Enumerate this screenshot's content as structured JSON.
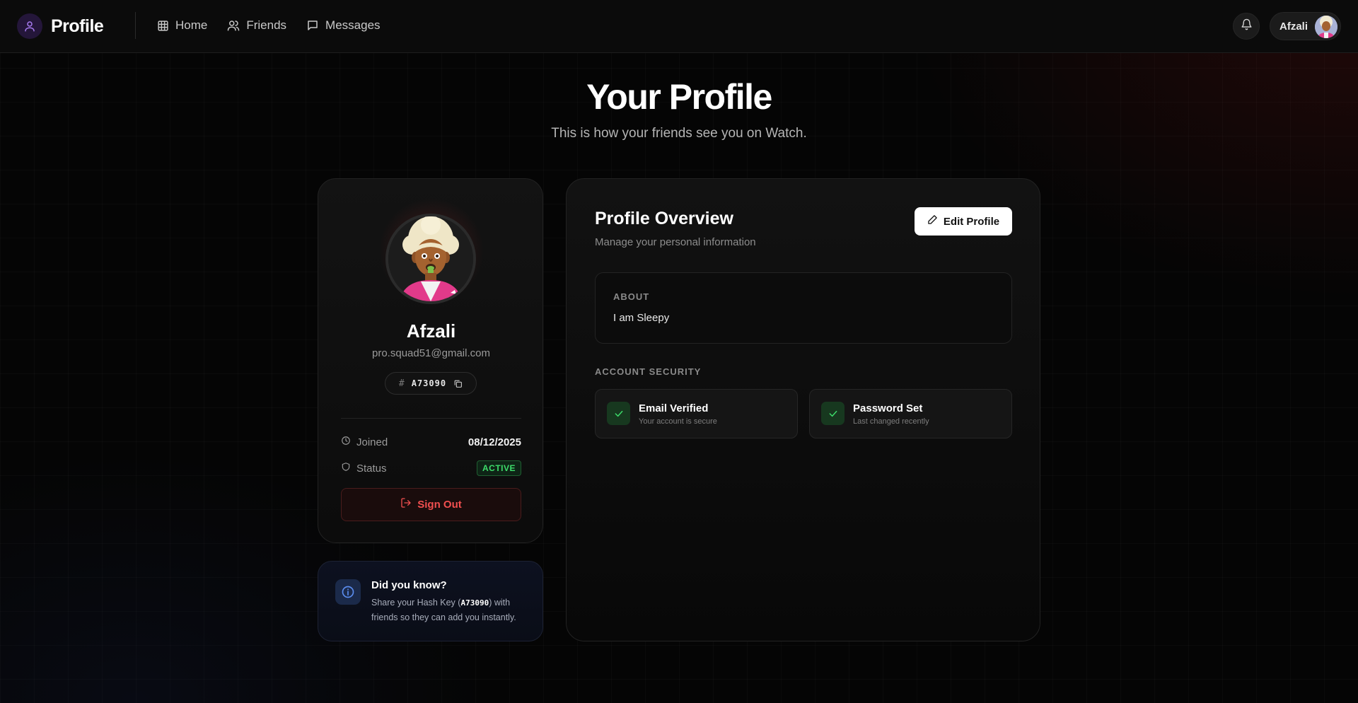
{
  "nav": {
    "brand": "Profile",
    "links": [
      {
        "label": "Home",
        "icon": "grid-icon"
      },
      {
        "label": "Friends",
        "icon": "users-icon"
      },
      {
        "label": "Messages",
        "icon": "message-icon"
      }
    ],
    "user_name": "Afzali"
  },
  "hero": {
    "title": "Your Profile",
    "subtitle": "This is how your friends see you on Watch."
  },
  "profile_card": {
    "name": "Afzali",
    "email": "pro.squad51@gmail.com",
    "hash_symbol": "#",
    "hash_key": "A73090",
    "joined_label": "Joined",
    "joined_value": "08/12/2025",
    "status_label": "Status",
    "status_value": "ACTIVE",
    "signout_label": "Sign Out"
  },
  "tip": {
    "title": "Did you know?",
    "body_prefix": "Share your Hash Key (",
    "code": "A73090",
    "body_suffix": ") with friends so they can add you instantly."
  },
  "overview": {
    "title": "Profile Overview",
    "subtitle": "Manage your personal information",
    "edit_label": "Edit Profile",
    "about_label": "ABOUT",
    "about_text": "I am Sleepy",
    "security_label": "ACCOUNT SECURITY",
    "security_items": [
      {
        "title": "Email Verified",
        "desc": "Your account is secure"
      },
      {
        "title": "Password Set",
        "desc": "Last changed recently"
      }
    ]
  },
  "colors": {
    "accent_purple": "#a77bf0",
    "active_green": "#3ddc6a",
    "danger_red": "#f04f4f",
    "info_blue": "#5b8def"
  }
}
